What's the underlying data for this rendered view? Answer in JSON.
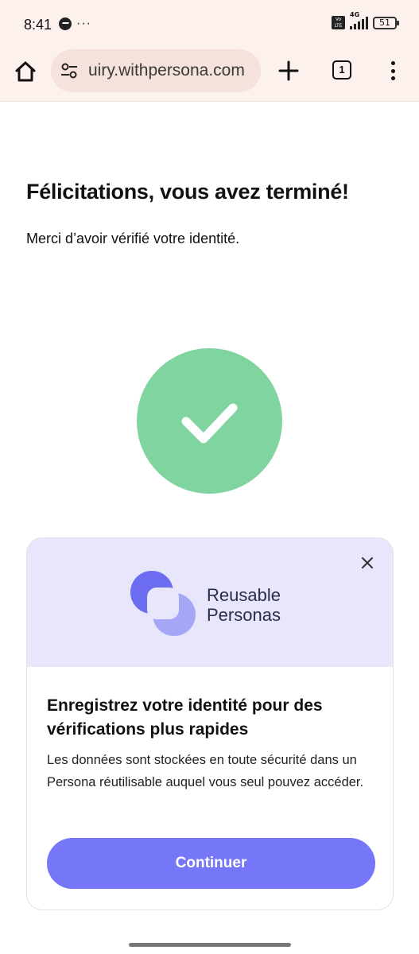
{
  "status_bar": {
    "time": "8:41",
    "overflow_indicator": "···",
    "network": "4G",
    "volte": "Vo LTE",
    "battery": "51"
  },
  "browser": {
    "url": "uiry.withpersona.com",
    "tab_count": "1"
  },
  "page": {
    "title": "Félicitations, vous avez terminé!",
    "subtitle": "Merci d’avoir vérifié votre identité.",
    "success_color": "#7fd49f"
  },
  "card": {
    "brand_line1": "Reusable",
    "brand_line2": "Personas",
    "heading": "Enregistrez votre identité pour des vérifications plus rapides",
    "body": "Les données sont stockées en toute sécurité dans un Persona réutilisable auquel vous seul pouvez accéder.",
    "button_label": "Continuer",
    "accent_color": "#7676f8",
    "banner_color": "#e7e6fb"
  },
  "icons": [
    "home-icon",
    "site-settings-icon",
    "plus-icon",
    "tabs-icon",
    "more-vert-icon",
    "checkmark-icon",
    "close-icon",
    "reusable-personas-logo-icon"
  ]
}
